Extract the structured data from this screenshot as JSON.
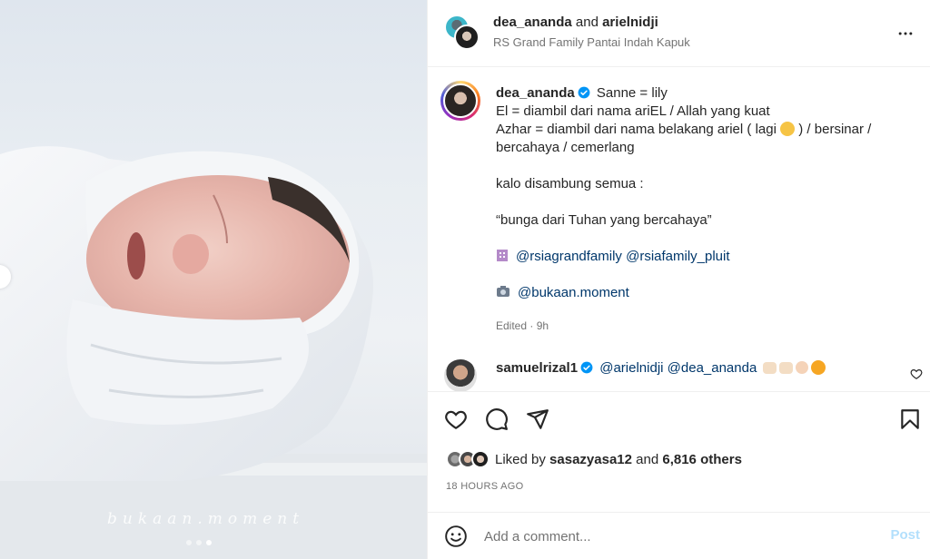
{
  "post": {
    "watermark": "bukaan.moment",
    "carousel": {
      "count": 3,
      "active_index": 2
    }
  },
  "header": {
    "user1": "dea_ananda",
    "joiner": "and",
    "user2": "arielnidji",
    "location": "RS Grand Family Pantai Indah Kapuk",
    "more_icon": "more-horizontal-icon"
  },
  "caption": {
    "username": "dea_ananda",
    "lines": [
      "Sanne = lily",
      "El = diambil dari nama ariEL / Allah yang kuat",
      "Azhar = diambil dari nama belakang ariel ( lagi",
      ") / bersinar /",
      "bercahaya / cemerlang",
      "kalo disambung semua :",
      "“bunga dari Tuhan yang bercahaya”",
      "@rsiagrandfamily @rsiafamily_pluit",
      "@bukaan.moment"
    ],
    "edited": "Edited · 9h"
  },
  "comment": {
    "username": "samuelrizal1",
    "text": "@arielnidji @dea_ananda"
  },
  "actions": {
    "like_icon": "heart-icon",
    "comment_icon": "comment-icon",
    "share_icon": "send-icon",
    "save_icon": "bookmark-icon"
  },
  "likes": {
    "prefix": "Liked by",
    "user": "sasazyasa12",
    "joiner": "and",
    "others": "6,816 others"
  },
  "timestamp": "18 HOURS AGO",
  "add_comment": {
    "placeholder": "Add a comment...",
    "post_label": "Post"
  },
  "colors": {
    "accent_link": "#00376b",
    "post_button_disabled": "#b2dffc",
    "verified_badge": "#0095f6",
    "muted_text": "#737373"
  }
}
